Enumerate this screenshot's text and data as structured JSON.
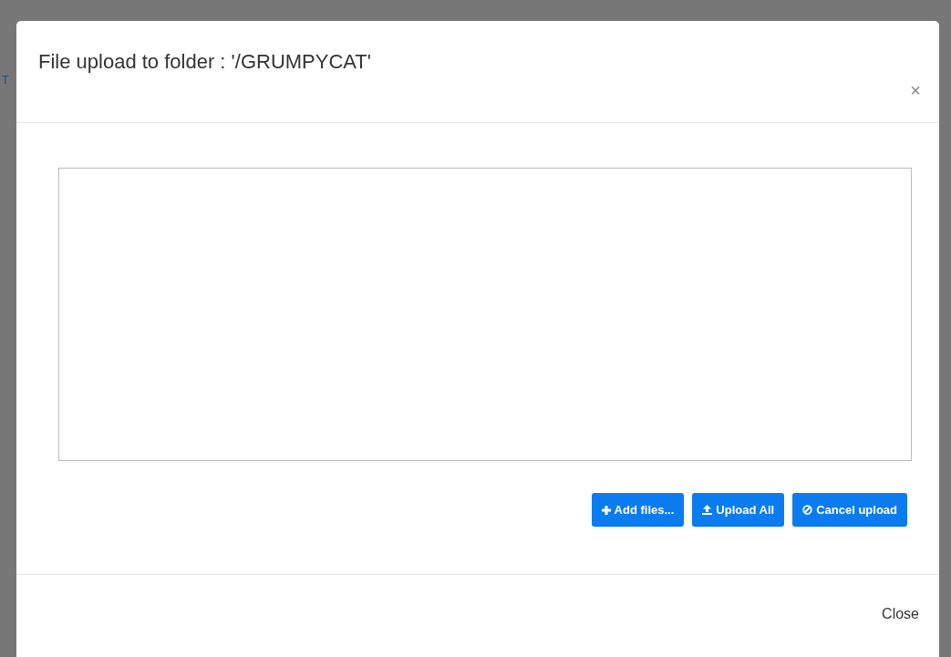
{
  "background": {
    "link_fragment": "T"
  },
  "dialog": {
    "title": "File upload to folder : '/GRUMPYCAT'",
    "close_glyph": "×",
    "buttons": [
      {
        "label": "Add files...",
        "kind": "add"
      },
      {
        "label": "Upload All",
        "kind": "upload"
      },
      {
        "label": "Cancel upload",
        "kind": "cancel"
      }
    ],
    "footer_button": "Close"
  }
}
